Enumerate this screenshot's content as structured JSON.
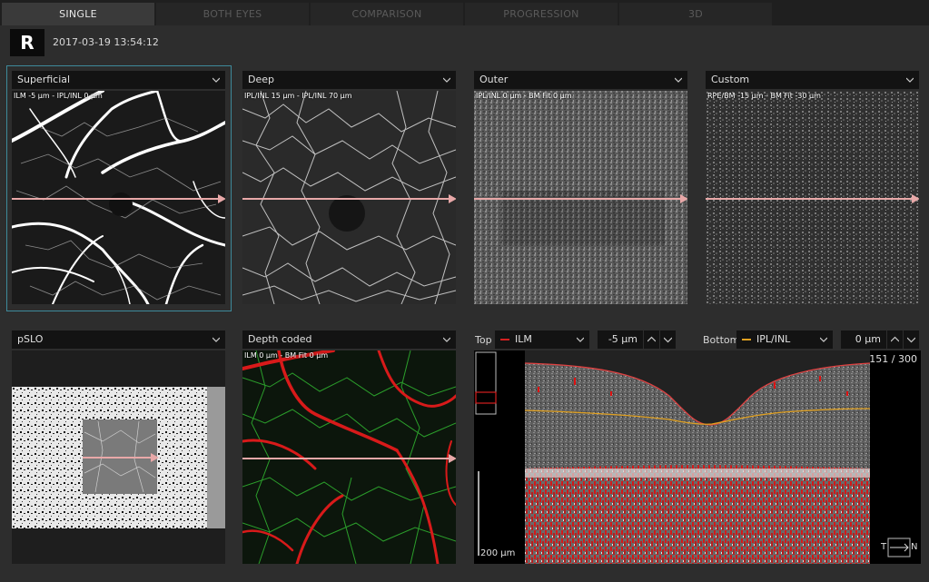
{
  "tabs": [
    {
      "label": "SINGLE"
    },
    {
      "label": "BOTH EYES"
    },
    {
      "label": "COMPARISON"
    },
    {
      "label": "PROGRESSION"
    },
    {
      "label": "3D"
    }
  ],
  "header": {
    "eye": "R",
    "timestamp": "2017-03-19 13:54:12"
  },
  "panels": {
    "superficial": {
      "name": "Superficial",
      "overlay": "ILM -5 μm - IPL/INL 0 μm"
    },
    "deep": {
      "name": "Deep",
      "overlay": "IPL/INL 15 μm - IPL/INL 70 μm"
    },
    "outer": {
      "name": "Outer",
      "overlay": "IPL/INL 0 μm - BM Fit 0 μm"
    },
    "custom": {
      "name": "Custom",
      "overlay": "RPE/BM -15 μm - BM Fit -30 μm"
    },
    "pslo": {
      "name": "pSLO"
    },
    "depth_coded": {
      "name": "Depth coded",
      "overlay": "ILM 0 μm - BM Fit 0 μm"
    }
  },
  "segmentation": {
    "top_label": "Top",
    "top_layer": "ILM",
    "top_color": "#d42020",
    "top_offset": "-5 μm",
    "bottom_label": "Bottom",
    "bottom_layer": "IPL/INL",
    "bottom_color": "#e0a020",
    "bottom_offset": "0 μm"
  },
  "bscan": {
    "slice": "151 / 300",
    "scale": "200 μm",
    "orient_t": "T",
    "orient_n": "N"
  },
  "colors": {
    "accent_frame": "#3e8a9b",
    "arrow": "#e8a8a8",
    "vessel_red": "#d81a1a",
    "vessel_green": "#2fae2f"
  }
}
